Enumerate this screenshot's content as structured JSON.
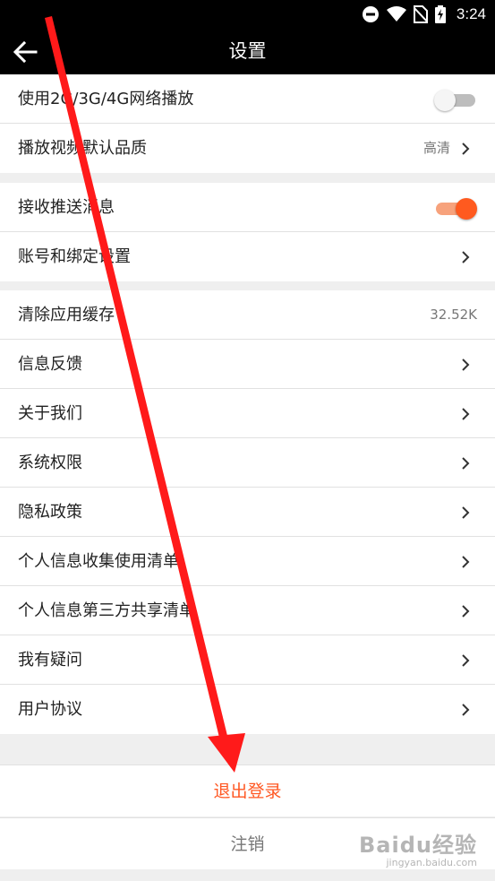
{
  "status_bar": {
    "time": "3:24"
  },
  "toolbar": {
    "title": "设置"
  },
  "settings": {
    "network_playback": {
      "label": "使用2G/3G/4G网络播放",
      "enabled": false
    },
    "default_quality": {
      "label": "播放视频默认品质",
      "value": "高清"
    },
    "push": {
      "label": "接收推送消息",
      "enabled": true
    },
    "account": {
      "label": "账号和绑定设置"
    },
    "cache": {
      "label": "清除应用缓存",
      "value": "32.52K"
    },
    "feedback": {
      "label": "信息反馈"
    },
    "about": {
      "label": "关于我们"
    },
    "permissions": {
      "label": "系统权限"
    },
    "privacy": {
      "label": "隐私政策"
    },
    "info_list": {
      "label": "个人信息收集使用清单"
    },
    "third_party": {
      "label": "个人信息第三方共享清单"
    },
    "faq": {
      "label": "我有疑问"
    },
    "agreement": {
      "label": "用户协议"
    }
  },
  "actions": {
    "logout": "退出登录",
    "cancel_account": "注销"
  },
  "colors": {
    "accent": "#ff5a1f",
    "logout_text": "#ff5722",
    "arrow_annotation": "#ff1a1a"
  },
  "watermark": {
    "main": "Baidu经验",
    "sub": "jingyan.baidu.com"
  }
}
